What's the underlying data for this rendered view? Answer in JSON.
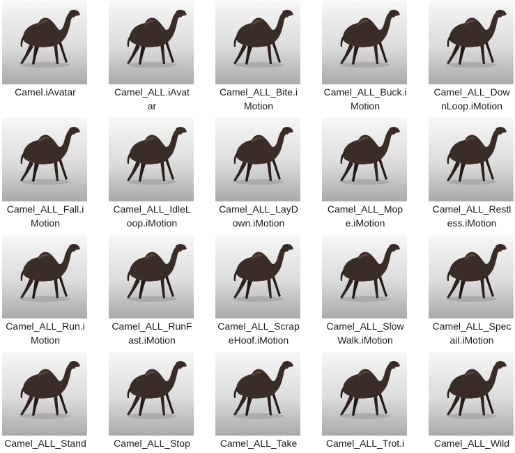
{
  "files": [
    {
      "name": "Camel.iAvatar",
      "lines": [
        "Camel.iAvatar"
      ]
    },
    {
      "name": "Camel_ALL.iAvatar",
      "lines": [
        "Camel_ALL.iAvat",
        "ar"
      ]
    },
    {
      "name": "Camel_ALL_Bite.iMotion",
      "lines": [
        "Camel_ALL_Bite.i",
        "Motion"
      ]
    },
    {
      "name": "Camel_ALL_Buck.iMotion",
      "lines": [
        "Camel_ALL_Buck.i",
        "Motion"
      ]
    },
    {
      "name": "Camel_ALL_DownLoop.iMotion",
      "lines": [
        "Camel_ALL_Dow",
        "nLoop.iMotion"
      ]
    },
    {
      "name": "Camel_ALL_Fall.iMotion",
      "lines": [
        "Camel_ALL_Fall.i",
        "Motion"
      ]
    },
    {
      "name": "Camel_ALL_IdleLoop.iMotion",
      "lines": [
        "Camel_ALL_IdleL",
        "oop.iMotion"
      ]
    },
    {
      "name": "Camel_ALL_LayDown.iMotion",
      "lines": [
        "Camel_ALL_LayD",
        "own.iMotion"
      ]
    },
    {
      "name": "Camel_ALL_Mope.iMotion",
      "lines": [
        "Camel_ALL_Mop",
        "e.iMotion"
      ]
    },
    {
      "name": "Camel_ALL_Restless.iMotion",
      "lines": [
        "Camel_ALL_Restl",
        "ess.iMotion"
      ]
    },
    {
      "name": "Camel_ALL_Run.iMotion",
      "lines": [
        "Camel_ALL_Run.i",
        "Motion"
      ]
    },
    {
      "name": "Camel_ALL_RunFast.iMotion",
      "lines": [
        "Camel_ALL_RunF",
        "ast.iMotion"
      ]
    },
    {
      "name": "Camel_ALL_ScrapeHoof.iMotion",
      "lines": [
        "Camel_ALL_Scrap",
        "eHoof.iMotion"
      ]
    },
    {
      "name": "Camel_ALL_SlowWalk.iMotion",
      "lines": [
        "Camel_ALL_Slow",
        "Walk.iMotion"
      ]
    },
    {
      "name": "Camel_ALL_Special.iMotion",
      "lines": [
        "Camel_ALL_Spec",
        "ail.iMotion"
      ]
    },
    {
      "name": "Camel_ALL_Stand",
      "lines": [
        "Camel_ALL_Stand"
      ]
    },
    {
      "name": "Camel_ALL_Stop",
      "lines": [
        "Camel_ALL_Stop"
      ]
    },
    {
      "name": "Camel_ALL_Take",
      "lines": [
        "Camel_ALL_Take"
      ]
    },
    {
      "name": "Camel_ALL_Trot.i",
      "lines": [
        "Camel_ALL_Trot.i"
      ]
    },
    {
      "name": "Camel_ALL_Wild",
      "lines": [
        "Camel_ALL_Wild"
      ]
    }
  ],
  "thumbnail_icon": "camel-thumbnail-icon"
}
